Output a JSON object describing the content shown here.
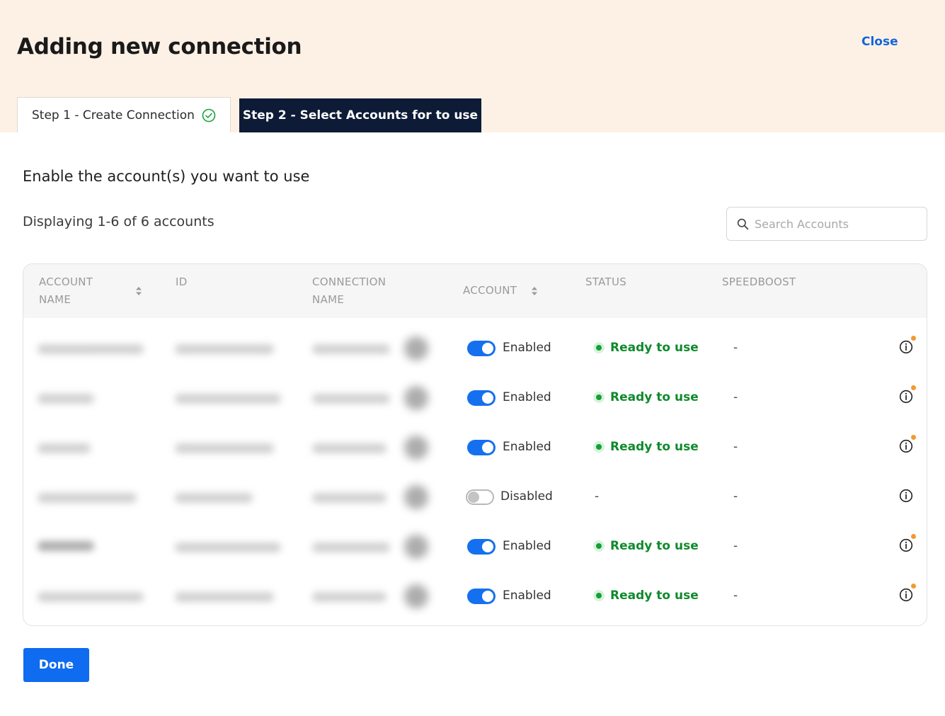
{
  "header": {
    "title": "Adding new connection",
    "close_label": "Close"
  },
  "steps": [
    {
      "label": "Step 1 - Create Connection",
      "completed": true
    },
    {
      "label": "Step 2 - Select Accounts for to use",
      "active": true
    }
  ],
  "main": {
    "subtitle": "Enable the account(s) you want to use",
    "count_label": "Displaying 1-6 of 6 accounts"
  },
  "search": {
    "placeholder": "Search Accounts",
    "value": ""
  },
  "table": {
    "columns": {
      "account_name": "ACCOUNT NAME",
      "id": "ID",
      "connection_name": "CONNECTION NAME",
      "account": "ACCOUNT",
      "status": "STATUS",
      "speedboost": "SPEEDBOOST"
    },
    "rows": [
      {
        "enabled": true,
        "account_label": "Enabled",
        "status": "Ready to use",
        "speedboost": "-",
        "has_notification": true
      },
      {
        "enabled": true,
        "account_label": "Enabled",
        "status": "Ready to use",
        "speedboost": "-",
        "has_notification": true
      },
      {
        "enabled": true,
        "account_label": "Enabled",
        "status": "Ready to use",
        "speedboost": "-",
        "has_notification": true
      },
      {
        "enabled": false,
        "account_label": "Disabled",
        "status": "-",
        "speedboost": "-",
        "has_notification": false
      },
      {
        "enabled": true,
        "account_label": "Enabled",
        "status": "Ready to use",
        "speedboost": "-",
        "has_notification": true
      },
      {
        "enabled": true,
        "account_label": "Enabled",
        "status": "Ready to use",
        "speedboost": "-",
        "has_notification": true
      }
    ]
  },
  "footer": {
    "done_label": "Done"
  },
  "colors": {
    "header_bg": "#fdf1e6",
    "active_step_bg": "#0d1b36",
    "primary": "#1570ef",
    "success": "#0f8a2c",
    "notification": "#f29a2e"
  },
  "icons": {
    "step_complete": "check-circle-icon",
    "search": "search-icon",
    "sort": "sort-icon",
    "info": "info-icon"
  }
}
